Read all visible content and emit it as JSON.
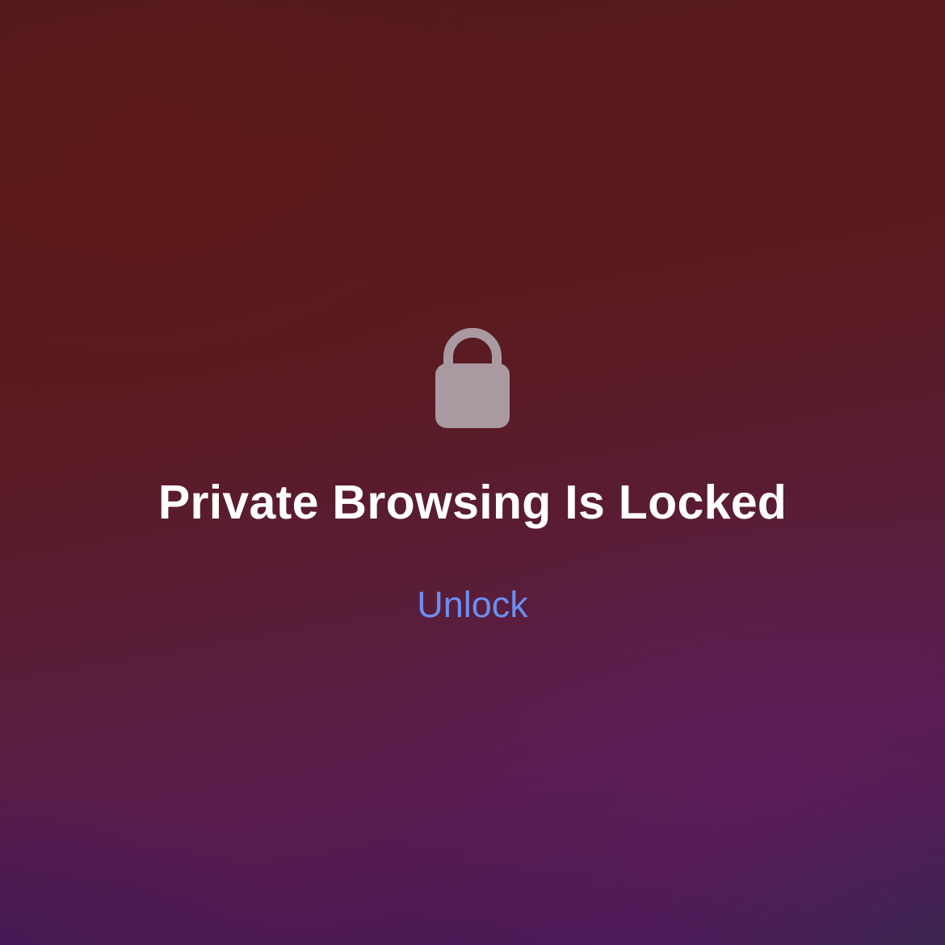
{
  "lock_screen": {
    "icon": "lock-icon",
    "title": "Private Browsing Is Locked",
    "unlock_label": "Unlock"
  },
  "colors": {
    "accent": "#6a8ff0",
    "title_text": "#ffffff",
    "icon_fill": "#a99aa2",
    "background_top": "#5a1a1c",
    "background_bottom": "#461a58"
  }
}
